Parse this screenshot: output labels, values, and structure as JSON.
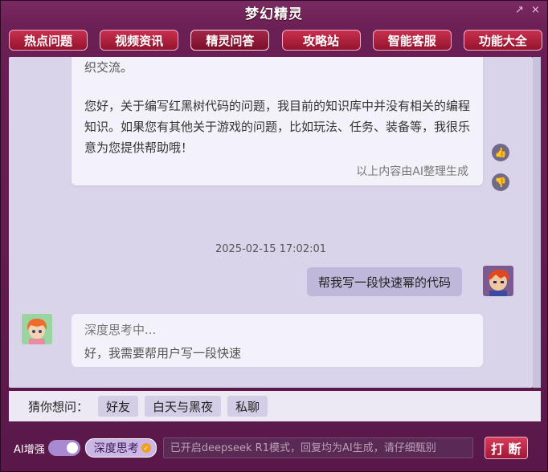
{
  "window": {
    "title": "梦幻精灵",
    "controls": [
      "↗",
      "×"
    ]
  },
  "tabs": [
    {
      "label": "热点问题"
    },
    {
      "label": "视频资讯"
    },
    {
      "label": "精灵问答",
      "active": true
    },
    {
      "label": "攻略站"
    },
    {
      "label": "智能客服"
    },
    {
      "label": "功能大全"
    }
  ],
  "chat": {
    "ai_message": {
      "cut_top_text": "织交流。",
      "text": "您好，关于编写红黑树代码的问题，我目前的知识库中并没有相关的编程知识。如果您有其他关于游戏的问题，比如玩法、任务、装备等，我很乐意为您提供帮助哦！",
      "note": "以上内容由AI整理生成"
    },
    "vote_up_icon": "thumbs-up-icon",
    "vote_down_icon": "thumbs-down-icon",
    "timestamp": "2025-02-15 17:02:01",
    "user_message": "帮我写一段快速幂的代码",
    "ai_thinking": {
      "status": "深度思考中...",
      "text": "好，我需要帮用户写一段快速"
    }
  },
  "suggest": {
    "label": "猜你想问：",
    "chips": [
      "好友",
      "白天与黑夜",
      "私聊"
    ]
  },
  "bottom": {
    "ai_enhance_label": "AI增强",
    "toggle_on": true,
    "deep_think_label": "深度思考",
    "input_placeholder": "已开启deepseek R1模式，回复均为AI生成，请仔细甄别",
    "send_label": "打 断"
  },
  "colors": {
    "accent": "#b01e3e",
    "chat_bg": "#d9d4ea",
    "user_bubble": "#bfb8da"
  }
}
